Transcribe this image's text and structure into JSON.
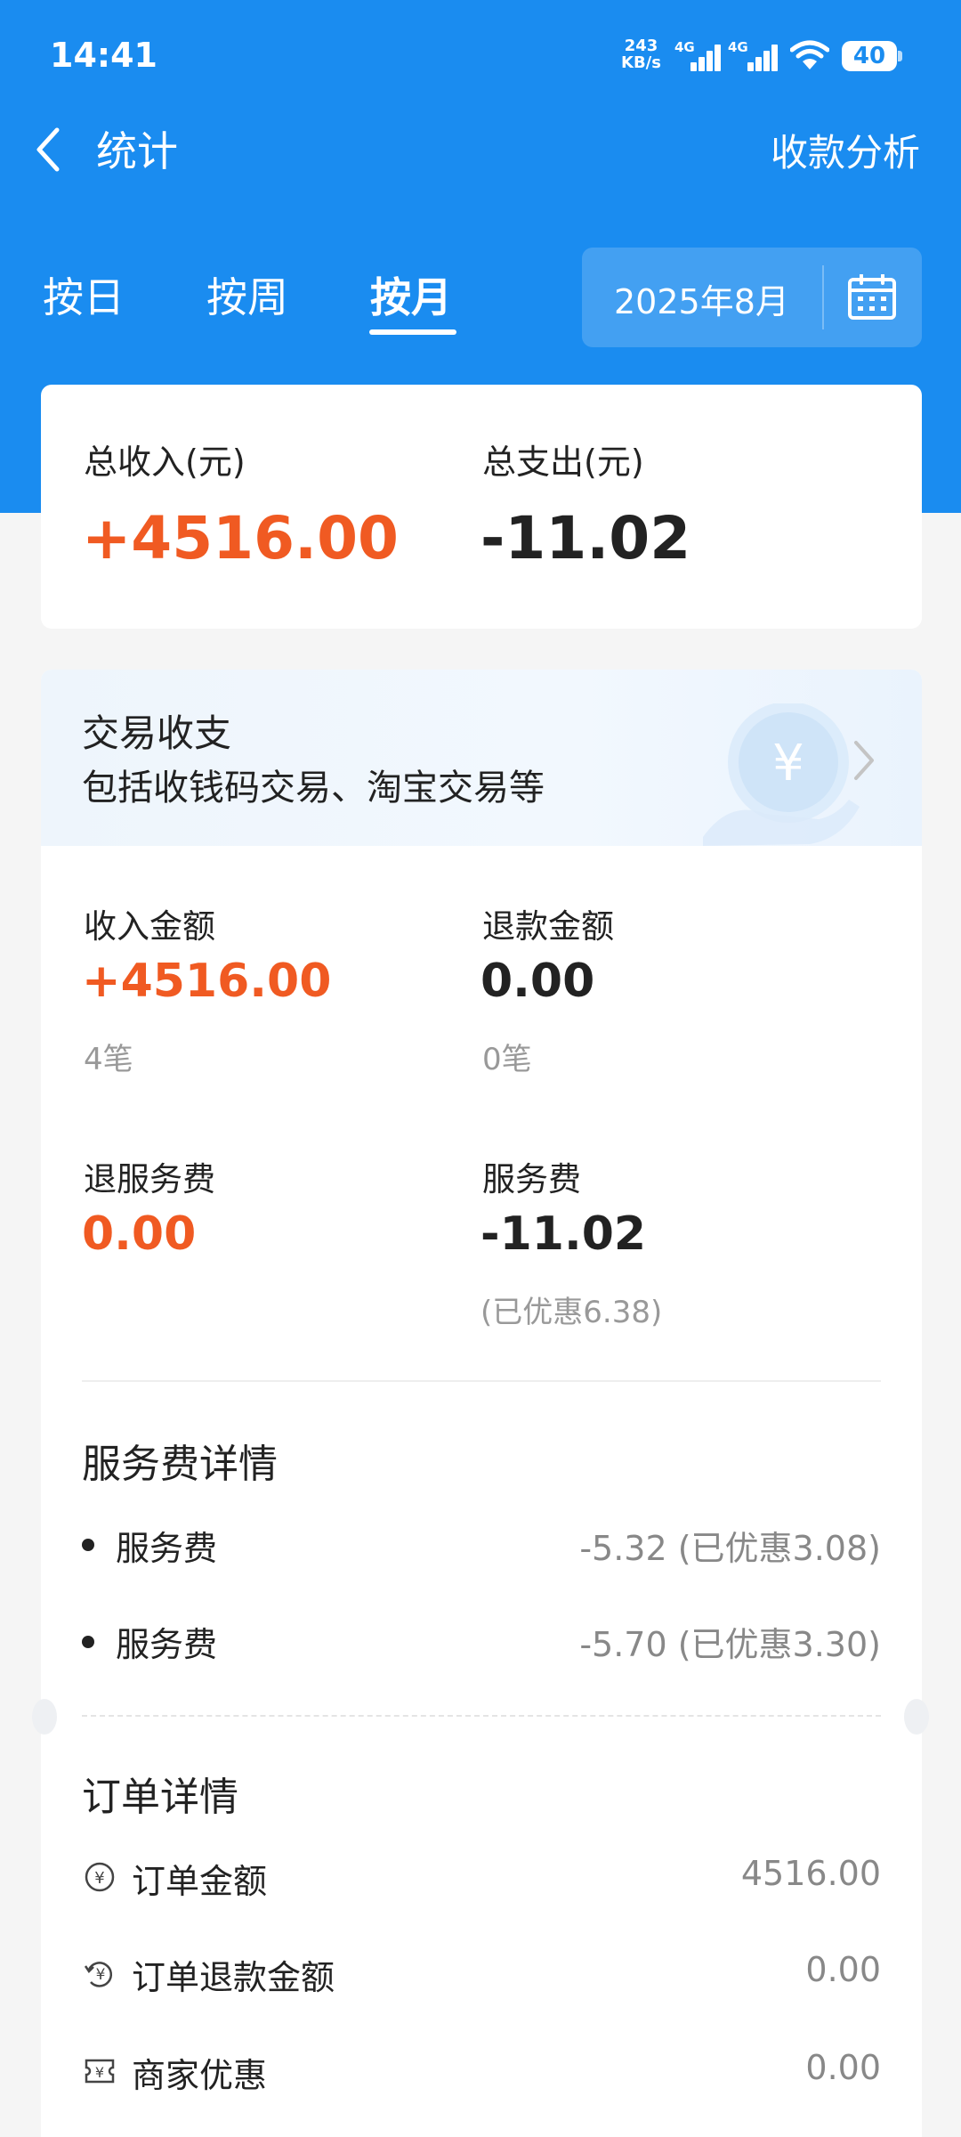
{
  "status_bar": {
    "time": "14:41",
    "speed_value": "243",
    "speed_unit": "KB/s",
    "network_1": "4G",
    "network_2": "4G",
    "battery": "40"
  },
  "nav": {
    "title": "统计",
    "action": "收款分析"
  },
  "tabs": [
    {
      "label": "按日",
      "active": false
    },
    {
      "label": "按周",
      "active": false
    },
    {
      "label": "按月",
      "active": true
    }
  ],
  "date_picker": {
    "value": "2025年8月"
  },
  "summary": {
    "income_label": "总收入(元)",
    "income_value": "+4516.00",
    "expense_label": "总支出(元)",
    "expense_value": "-11.02"
  },
  "transactions": {
    "title": "交易收支",
    "subtitle": "包括收钱码交易、淘宝交易等",
    "income_label": "收入金额",
    "income_value": "+4516.00",
    "income_count": "4笔",
    "refund_label": "退款金额",
    "refund_value": "0.00",
    "refund_count": "0笔",
    "refund_fee_label": "退服务费",
    "refund_fee_value": "0.00",
    "fee_label": "服务费",
    "fee_value": "-11.02",
    "fee_discount": "(已优惠6.38)"
  },
  "fee_details": {
    "title": "服务费详情",
    "items": [
      {
        "label": "服务费",
        "value": "-5.32 (已优惠3.08)"
      },
      {
        "label": "服务费",
        "value": "-5.70 (已优惠3.30)"
      }
    ]
  },
  "order_details": {
    "title": "订单详情",
    "items": [
      {
        "label": "订单金额",
        "value": "4516.00",
        "icon": "yuan-circle-icon"
      },
      {
        "label": "订单退款金额",
        "value": "0.00",
        "icon": "refund-yuan-icon"
      },
      {
        "label": "商家优惠",
        "value": "0.00",
        "icon": "coupon-icon"
      }
    ]
  },
  "colors": {
    "brand_blue": "#1a8cf0",
    "income_orange": "#f05a22"
  }
}
